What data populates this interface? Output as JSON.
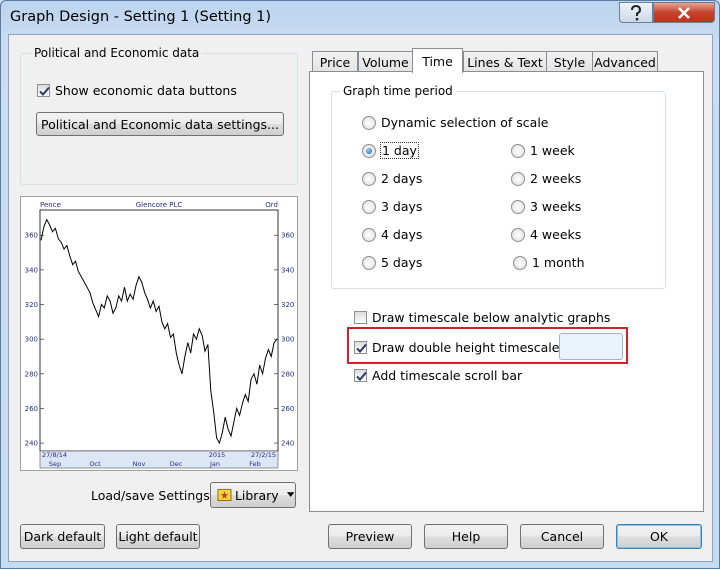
{
  "window": {
    "title": "Graph Design - Setting 1 (Setting 1)"
  },
  "left_panel": {
    "group_title": "Political and Economic data",
    "show_econ_label": "Show economic data buttons",
    "show_econ_checked": true,
    "settings_button": "Political and Economic data settings...",
    "load_save_label": "Load/save Settings",
    "library_button": "Library"
  },
  "chart": {
    "left_label": "Pence",
    "title": "Glencore PLC",
    "right_label": "Ord",
    "y_ticks": [
      "360",
      "340",
      "320",
      "300",
      "280",
      "260",
      "240"
    ],
    "start_date": "27/8/14",
    "end_date": "27/2/15",
    "year_label": "2015",
    "months": [
      "Sep",
      "Oct",
      "Nov",
      "Dec",
      "Jan",
      "Feb"
    ]
  },
  "chart_data": {
    "type": "line",
    "title": "Glencore PLC",
    "ylabel": "Pence",
    "ylim": [
      236,
      374
    ],
    "x_ticks": [
      "Sep",
      "Oct",
      "Nov",
      "Dec",
      "Jan",
      "Feb"
    ],
    "series": [
      {
        "values": [
          357,
          365,
          369,
          366,
          362,
          364,
          358,
          356,
          352,
          354,
          348,
          343,
          345,
          339,
          336,
          333,
          330,
          327,
          321,
          317,
          313,
          320,
          318,
          325,
          322,
          315,
          318,
          325,
          322,
          330,
          322,
          326,
          323,
          331,
          336,
          333,
          327,
          323,
          318,
          322,
          316,
          319,
          310,
          306,
          309,
          301,
          303,
          292,
          285,
          280,
          290,
          298,
          292,
          303,
          300,
          306,
          302,
          293,
          297,
          270,
          258,
          243,
          240,
          246,
          255,
          248,
          244,
          252,
          260,
          256,
          263,
          268,
          264,
          277,
          280,
          274,
          285,
          280,
          289,
          294,
          290,
          298,
          300
        ]
      }
    ]
  },
  "tabs": [
    "Price",
    "Volume",
    "Time",
    "Lines & Text",
    "Style",
    "Advanced"
  ],
  "active_tab": "Time",
  "time_tab": {
    "group_title": "Graph time period",
    "dynamic_label": "Dynamic selection of scale",
    "left_options": [
      "1 day",
      "2 days",
      "3 days",
      "4 days",
      "5 days"
    ],
    "right_options": [
      "1 week",
      "2 weeks",
      "3 weeks",
      "4 weeks",
      "1 month"
    ],
    "selected": "1 day",
    "draw_below_label": "Draw timescale below analytic graphs",
    "draw_below_checked": false,
    "double_height_label": "Draw double height timescale",
    "double_height_checked": true,
    "scroll_bar_label": "Add timescale scroll bar",
    "scroll_bar_checked": true,
    "swatch_color": "#eaf3fc",
    "highlight_color": "#d0212b"
  },
  "buttons": {
    "dark_default": "Dark default",
    "light_default": "Light default",
    "preview": "Preview",
    "help": "Help",
    "cancel": "Cancel",
    "ok": "OK"
  }
}
